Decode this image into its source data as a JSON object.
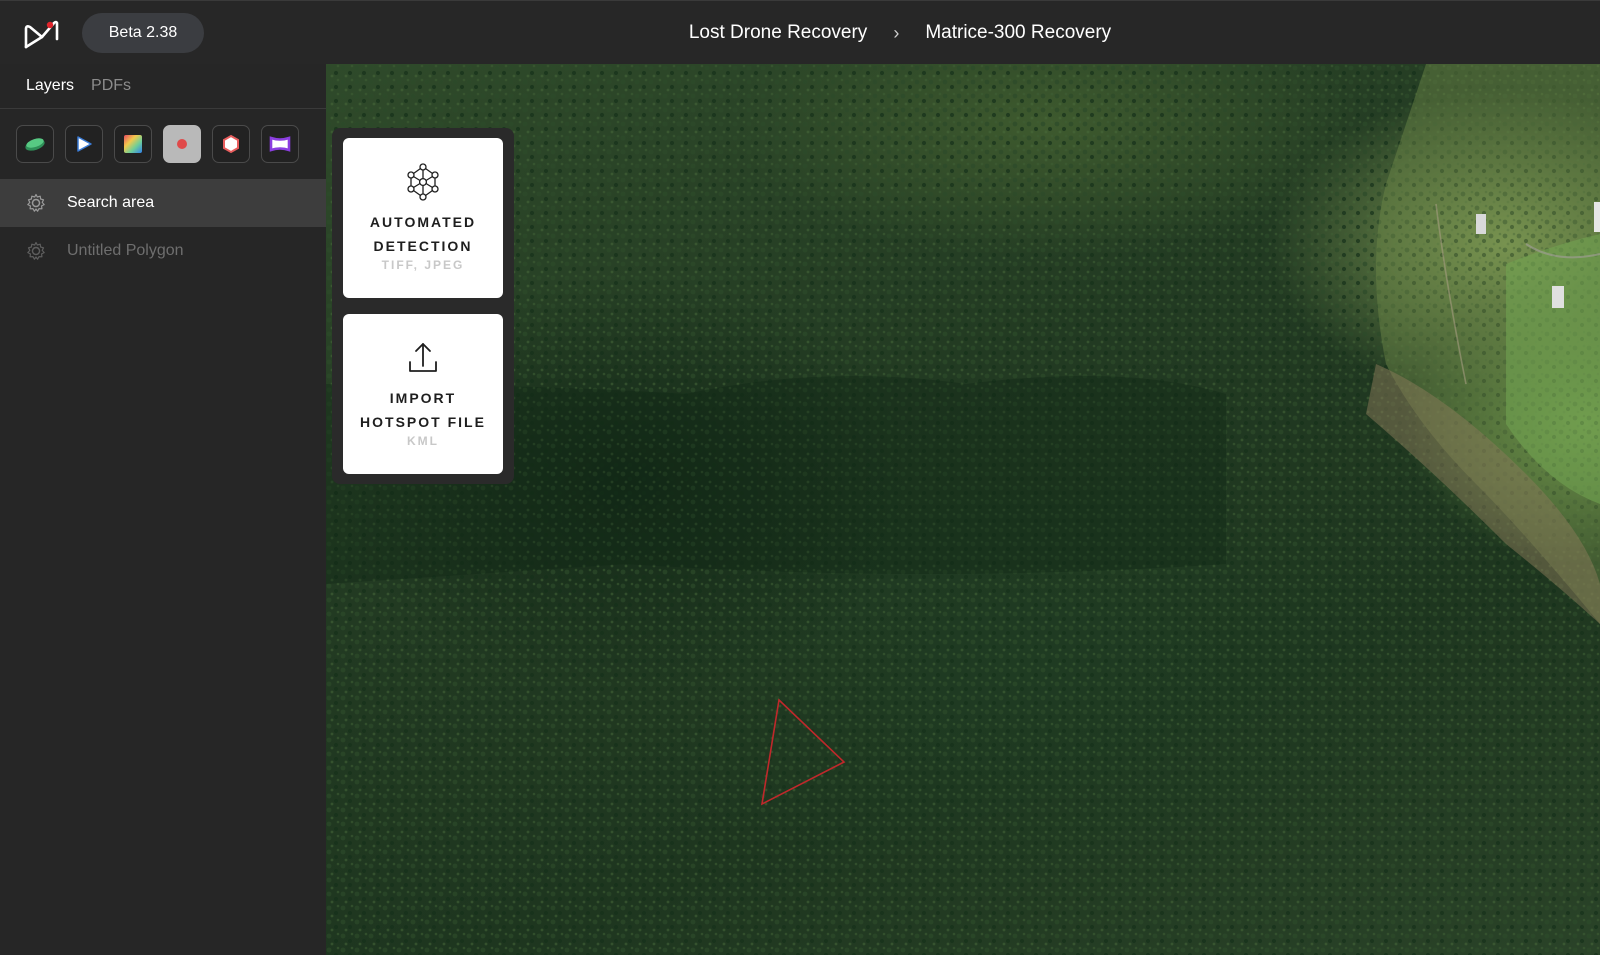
{
  "app": {
    "version_label": "Beta 2.38"
  },
  "breadcrumb": {
    "project": "Lost Drone Recovery",
    "mission": "Matrice-300 Recovery"
  },
  "sidebar": {
    "tabs": [
      {
        "label": "Layers",
        "active": true
      },
      {
        "label": "PDFs",
        "active": false
      }
    ],
    "tools": [
      {
        "icon": "layer-stack-icon",
        "color": "#3fae6f"
      },
      {
        "icon": "play-icon",
        "color": "#3a7bd5"
      },
      {
        "icon": "color-gradient-icon",
        "color": "#e8b83a"
      },
      {
        "icon": "red-dot-icon",
        "color": "#e04a4a",
        "active": true
      },
      {
        "icon": "hexagon-icon",
        "color": "#e85d5d"
      },
      {
        "icon": "rectangle-icon",
        "color": "#8b3ee0"
      }
    ],
    "layers": [
      {
        "label": "Search area",
        "selected": true
      },
      {
        "label": "Untitled Polygon",
        "selected": false
      }
    ]
  },
  "actions": [
    {
      "title_line1": "AUTOMATED",
      "title_line2": "DETECTION",
      "subtitle": "TIFF, JPEG",
      "icon": "neural-network-icon"
    },
    {
      "title_line1": "IMPORT",
      "title_line2": "HOTSPOT FILE",
      "subtitle": "KML",
      "icon": "upload-icon"
    }
  ],
  "map": {
    "annotation_color": "#c0282b"
  }
}
